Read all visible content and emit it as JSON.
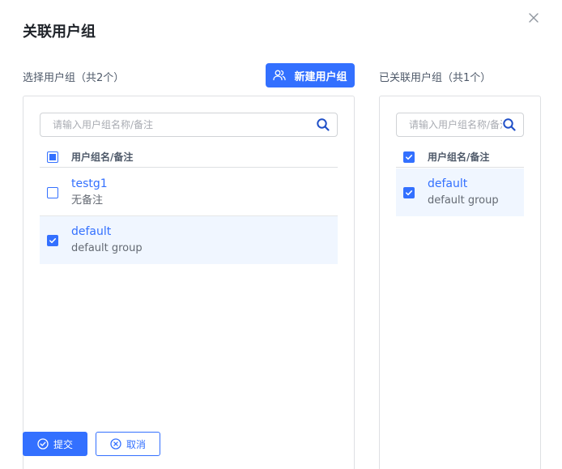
{
  "dialog": {
    "title": "关联用户组"
  },
  "left": {
    "label": "选择用户组（共2个）",
    "new_group_label": "新建用户组",
    "search_placeholder": "请输入用户组名称/备注",
    "header": "用户组名/备注",
    "header_check_state": "partial",
    "items": [
      {
        "name": "testg1",
        "note": "无备注",
        "checked": false
      },
      {
        "name": "default",
        "note": "default group",
        "checked": true
      }
    ]
  },
  "right": {
    "label": "已关联用户组（共1个）",
    "search_placeholder": "请输入用户组名称/备注",
    "header": "用户组名/备注",
    "header_check_state": "checked",
    "items": [
      {
        "name": "default",
        "note": "default group",
        "checked": true
      }
    ]
  },
  "footer": {
    "submit_label": "提交",
    "cancel_label": "取消"
  },
  "colors": {
    "accent": "#3370ff",
    "selected_row": "#f0f6ff"
  }
}
